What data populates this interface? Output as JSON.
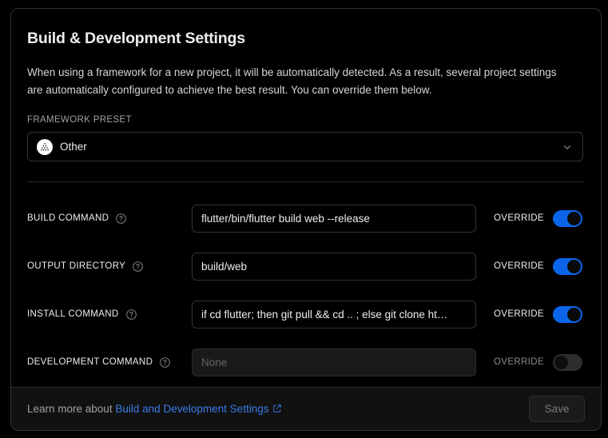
{
  "card": {
    "title": "Build & Development Settings",
    "description": "When using a framework for a new project, it will be automatically detected. As a result, several project settings are automatically configured to achieve the best result. You can override them below."
  },
  "framework_preset": {
    "label": "FRAMEWORK PRESET",
    "selected": "Other",
    "icon": "other-framework-icon",
    "chevron": "chevron-down-icon"
  },
  "rows": [
    {
      "label": "BUILD COMMAND",
      "help": "help-icon",
      "value": "flutter/bin/flutter build web --release",
      "placeholder": "",
      "disabled": false,
      "override_label": "OVERRIDE",
      "override_on": true
    },
    {
      "label": "OUTPUT DIRECTORY",
      "help": "help-icon",
      "value": "build/web",
      "placeholder": "",
      "disabled": false,
      "override_label": "OVERRIDE",
      "override_on": true
    },
    {
      "label": "INSTALL COMMAND",
      "help": "help-icon",
      "value": "if cd flutter; then git pull && cd .. ; else git clone ht…",
      "placeholder": "",
      "disabled": false,
      "override_label": "OVERRIDE",
      "override_on": true
    },
    {
      "label": "DEVELOPMENT COMMAND",
      "help": "help-icon",
      "value": "",
      "placeholder": "None",
      "disabled": true,
      "override_label": "OVERRIDE",
      "override_on": false
    }
  ],
  "footer": {
    "learn_more_prefix": "Learn more about",
    "link_text": "Build and Development Settings",
    "external_icon": "external-link-icon",
    "save_label": "Save"
  },
  "colors": {
    "accent_blue": "#0b65e8",
    "link_blue": "#3b7ce8",
    "card_bg": "#000000",
    "footer_bg": "#111111",
    "border": "#333333"
  }
}
